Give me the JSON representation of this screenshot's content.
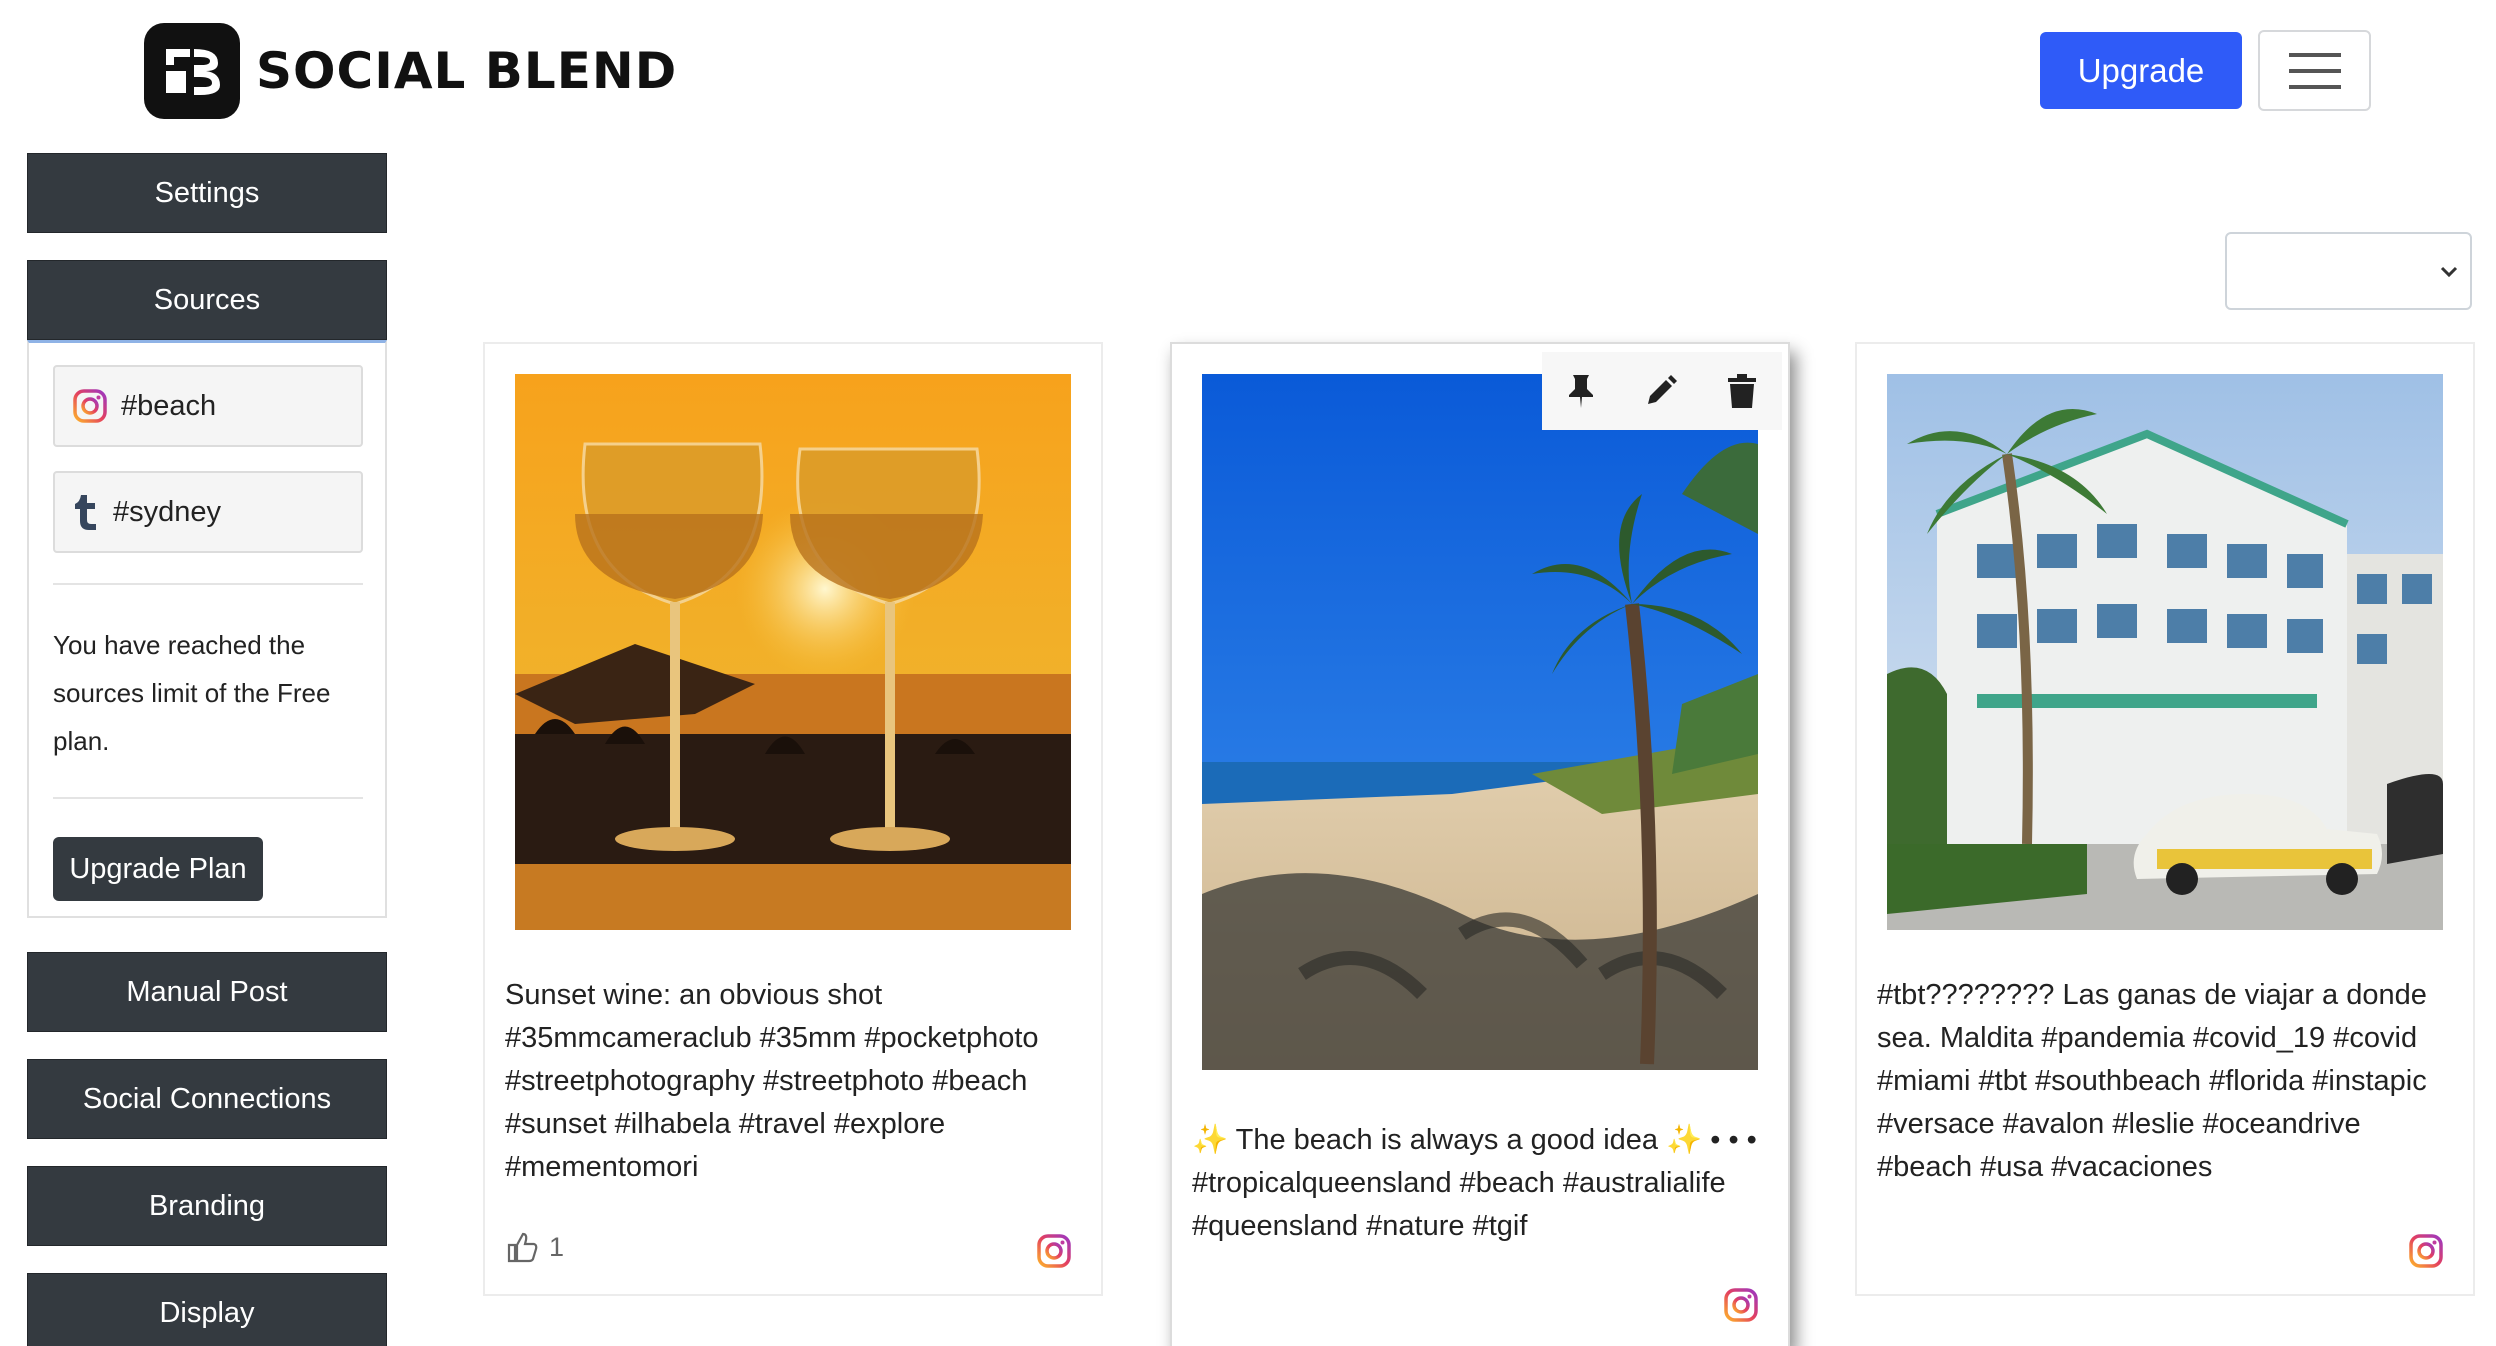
{
  "brand": {
    "name": "SOCIAL BLEND"
  },
  "header": {
    "upgrade_label": "Upgrade",
    "menu_icon": "hamburger-icon"
  },
  "sidebar": {
    "settings_label": "Settings",
    "sources_label": "Sources",
    "sources": [
      {
        "platform": "instagram",
        "icon": "instagram-icon",
        "label": "#beach"
      },
      {
        "platform": "tumblr",
        "icon": "tumblr-icon",
        "label": "#sydney"
      }
    ],
    "limit_message": "You have reached the sources limit of the Free plan.",
    "upgrade_plan_label": "Upgrade Plan",
    "manual_post_label": "Manual Post",
    "social_connections_label": "Social Connections",
    "branding_label": "Branding",
    "display_label": "Display"
  },
  "filter_select": {
    "selected": ""
  },
  "posts": [
    {
      "caption": "Sunset wine: an obvious shot #35mmcameraclub #35mm #pocketphoto #streetphotography #streetphoto #beach #sunset #ilhabela #travel #explore #mementomori",
      "likes": "1",
      "source_icon": "instagram-icon"
    },
    {
      "caption": "✨ The beach is always a good idea ✨ • • • #tropicalqueensland #beach #australialife #queensland #nature #tgif",
      "source_icon": "instagram-icon",
      "actions": [
        "pin-icon",
        "edit-icon",
        "delete-icon"
      ]
    },
    {
      "caption": "#tbt???????? Las ganas de viajar a donde sea. Maldita #pandemia #covid_19 #covid #miami #tbt #southbeach #florida #instapic #versace #avalon #leslie #oceandrive #beach #usa #vacaciones",
      "source_icon": "instagram-icon"
    }
  ],
  "colors": {
    "primary": "#2f5bf8",
    "dark": "#343a40",
    "instagram": "#d6249f"
  }
}
